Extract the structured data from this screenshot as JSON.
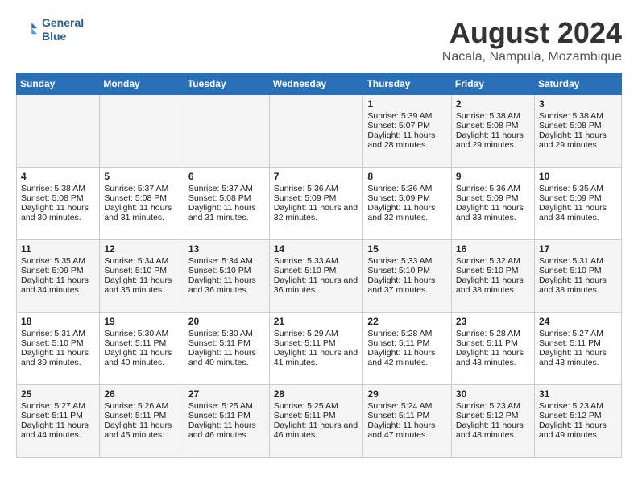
{
  "header": {
    "logo_line1": "General",
    "logo_line2": "Blue",
    "main_title": "August 2024",
    "subtitle": "Nacala, Nampula, Mozambique"
  },
  "weekdays": [
    "Sunday",
    "Monday",
    "Tuesday",
    "Wednesday",
    "Thursday",
    "Friday",
    "Saturday"
  ],
  "weeks": [
    [
      {
        "day": "",
        "sunrise": "",
        "sunset": "",
        "daylight": ""
      },
      {
        "day": "",
        "sunrise": "",
        "sunset": "",
        "daylight": ""
      },
      {
        "day": "",
        "sunrise": "",
        "sunset": "",
        "daylight": ""
      },
      {
        "day": "",
        "sunrise": "",
        "sunset": "",
        "daylight": ""
      },
      {
        "day": "1",
        "sunrise": "Sunrise: 5:39 AM",
        "sunset": "Sunset: 5:07 PM",
        "daylight": "Daylight: 11 hours and 28 minutes."
      },
      {
        "day": "2",
        "sunrise": "Sunrise: 5:38 AM",
        "sunset": "Sunset: 5:08 PM",
        "daylight": "Daylight: 11 hours and 29 minutes."
      },
      {
        "day": "3",
        "sunrise": "Sunrise: 5:38 AM",
        "sunset": "Sunset: 5:08 PM",
        "daylight": "Daylight: 11 hours and 29 minutes."
      }
    ],
    [
      {
        "day": "4",
        "sunrise": "Sunrise: 5:38 AM",
        "sunset": "Sunset: 5:08 PM",
        "daylight": "Daylight: 11 hours and 30 minutes."
      },
      {
        "day": "5",
        "sunrise": "Sunrise: 5:37 AM",
        "sunset": "Sunset: 5:08 PM",
        "daylight": "Daylight: 11 hours and 31 minutes."
      },
      {
        "day": "6",
        "sunrise": "Sunrise: 5:37 AM",
        "sunset": "Sunset: 5:08 PM",
        "daylight": "Daylight: 11 hours and 31 minutes."
      },
      {
        "day": "7",
        "sunrise": "Sunrise: 5:36 AM",
        "sunset": "Sunset: 5:09 PM",
        "daylight": "Daylight: 11 hours and 32 minutes."
      },
      {
        "day": "8",
        "sunrise": "Sunrise: 5:36 AM",
        "sunset": "Sunset: 5:09 PM",
        "daylight": "Daylight: 11 hours and 32 minutes."
      },
      {
        "day": "9",
        "sunrise": "Sunrise: 5:36 AM",
        "sunset": "Sunset: 5:09 PM",
        "daylight": "Daylight: 11 hours and 33 minutes."
      },
      {
        "day": "10",
        "sunrise": "Sunrise: 5:35 AM",
        "sunset": "Sunset: 5:09 PM",
        "daylight": "Daylight: 11 hours and 34 minutes."
      }
    ],
    [
      {
        "day": "11",
        "sunrise": "Sunrise: 5:35 AM",
        "sunset": "Sunset: 5:09 PM",
        "daylight": "Daylight: 11 hours and 34 minutes."
      },
      {
        "day": "12",
        "sunrise": "Sunrise: 5:34 AM",
        "sunset": "Sunset: 5:10 PM",
        "daylight": "Daylight: 11 hours and 35 minutes."
      },
      {
        "day": "13",
        "sunrise": "Sunrise: 5:34 AM",
        "sunset": "Sunset: 5:10 PM",
        "daylight": "Daylight: 11 hours and 36 minutes."
      },
      {
        "day": "14",
        "sunrise": "Sunrise: 5:33 AM",
        "sunset": "Sunset: 5:10 PM",
        "daylight": "Daylight: 11 hours and 36 minutes."
      },
      {
        "day": "15",
        "sunrise": "Sunrise: 5:33 AM",
        "sunset": "Sunset: 5:10 PM",
        "daylight": "Daylight: 11 hours and 37 minutes."
      },
      {
        "day": "16",
        "sunrise": "Sunrise: 5:32 AM",
        "sunset": "Sunset: 5:10 PM",
        "daylight": "Daylight: 11 hours and 38 minutes."
      },
      {
        "day": "17",
        "sunrise": "Sunrise: 5:31 AM",
        "sunset": "Sunset: 5:10 PM",
        "daylight": "Daylight: 11 hours and 38 minutes."
      }
    ],
    [
      {
        "day": "18",
        "sunrise": "Sunrise: 5:31 AM",
        "sunset": "Sunset: 5:10 PM",
        "daylight": "Daylight: 11 hours and 39 minutes."
      },
      {
        "day": "19",
        "sunrise": "Sunrise: 5:30 AM",
        "sunset": "Sunset: 5:11 PM",
        "daylight": "Daylight: 11 hours and 40 minutes."
      },
      {
        "day": "20",
        "sunrise": "Sunrise: 5:30 AM",
        "sunset": "Sunset: 5:11 PM",
        "daylight": "Daylight: 11 hours and 40 minutes."
      },
      {
        "day": "21",
        "sunrise": "Sunrise: 5:29 AM",
        "sunset": "Sunset: 5:11 PM",
        "daylight": "Daylight: 11 hours and 41 minutes."
      },
      {
        "day": "22",
        "sunrise": "Sunrise: 5:28 AM",
        "sunset": "Sunset: 5:11 PM",
        "daylight": "Daylight: 11 hours and 42 minutes."
      },
      {
        "day": "23",
        "sunrise": "Sunrise: 5:28 AM",
        "sunset": "Sunset: 5:11 PM",
        "daylight": "Daylight: 11 hours and 43 minutes."
      },
      {
        "day": "24",
        "sunrise": "Sunrise: 5:27 AM",
        "sunset": "Sunset: 5:11 PM",
        "daylight": "Daylight: 11 hours and 43 minutes."
      }
    ],
    [
      {
        "day": "25",
        "sunrise": "Sunrise: 5:27 AM",
        "sunset": "Sunset: 5:11 PM",
        "daylight": "Daylight: 11 hours and 44 minutes."
      },
      {
        "day": "26",
        "sunrise": "Sunrise: 5:26 AM",
        "sunset": "Sunset: 5:11 PM",
        "daylight": "Daylight: 11 hours and 45 minutes."
      },
      {
        "day": "27",
        "sunrise": "Sunrise: 5:25 AM",
        "sunset": "Sunset: 5:11 PM",
        "daylight": "Daylight: 11 hours and 46 minutes."
      },
      {
        "day": "28",
        "sunrise": "Sunrise: 5:25 AM",
        "sunset": "Sunset: 5:11 PM",
        "daylight": "Daylight: 11 hours and 46 minutes."
      },
      {
        "day": "29",
        "sunrise": "Sunrise: 5:24 AM",
        "sunset": "Sunset: 5:11 PM",
        "daylight": "Daylight: 11 hours and 47 minutes."
      },
      {
        "day": "30",
        "sunrise": "Sunrise: 5:23 AM",
        "sunset": "Sunset: 5:12 PM",
        "daylight": "Daylight: 11 hours and 48 minutes."
      },
      {
        "day": "31",
        "sunrise": "Sunrise: 5:23 AM",
        "sunset": "Sunset: 5:12 PM",
        "daylight": "Daylight: 11 hours and 49 minutes."
      }
    ]
  ]
}
